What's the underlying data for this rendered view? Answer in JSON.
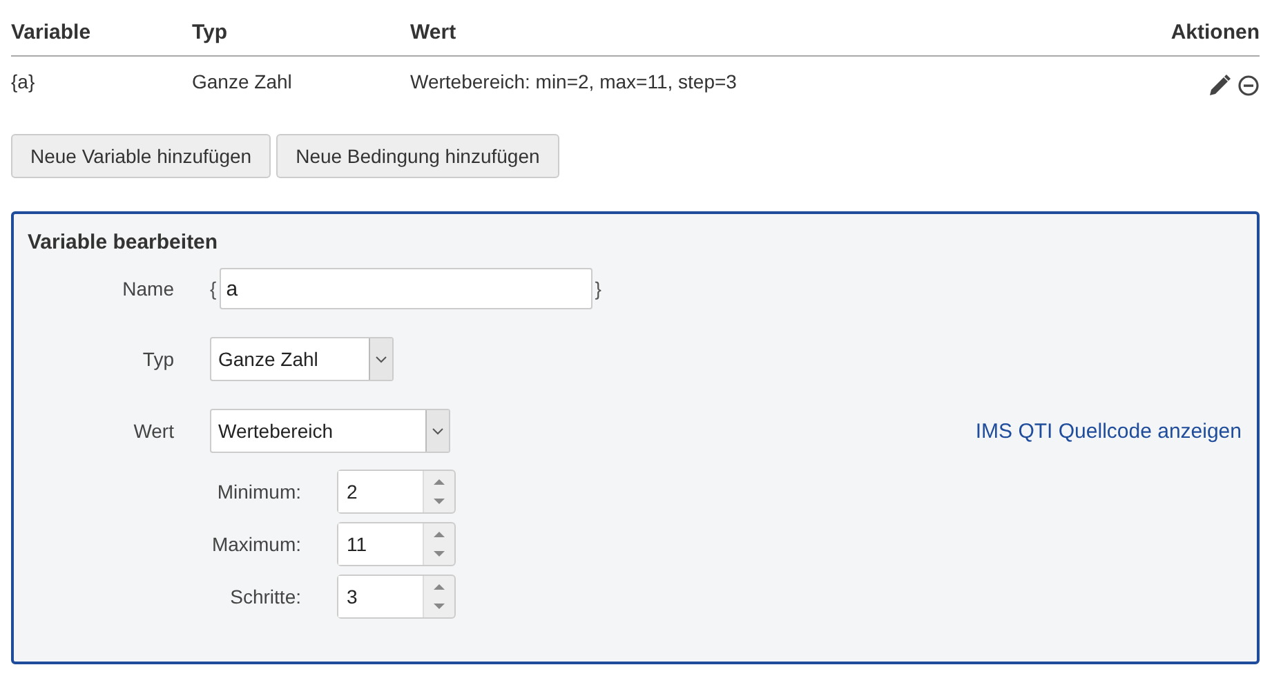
{
  "table": {
    "columns": [
      "Variable",
      "Typ",
      "Wert",
      "Aktionen"
    ],
    "rows": [
      {
        "cells": [
          "{a}",
          "Ganze Zahl",
          "Wertebereich: min=2, max=11, step=3"
        ]
      }
    ]
  },
  "buttons": [
    "Neue Variable hinzufügen",
    "Neue Bedingung hinzufügen"
  ],
  "editor": {
    "title": "Variable bearbeiten",
    "name": {
      "label": "Name",
      "open": "{",
      "value": "a",
      "close": "}"
    },
    "type": {
      "label": "Typ",
      "value": "Ganze Zahl"
    },
    "value": {
      "label": "Wert",
      "value": "Wertebereich"
    },
    "range": [
      {
        "label": "Minimum:",
        "value": "2"
      },
      {
        "label": "Maximum:",
        "value": "11"
      },
      {
        "label": "Schritte:",
        "value": "3"
      }
    ],
    "link": "IMS QTI Quellcode anzeigen"
  }
}
